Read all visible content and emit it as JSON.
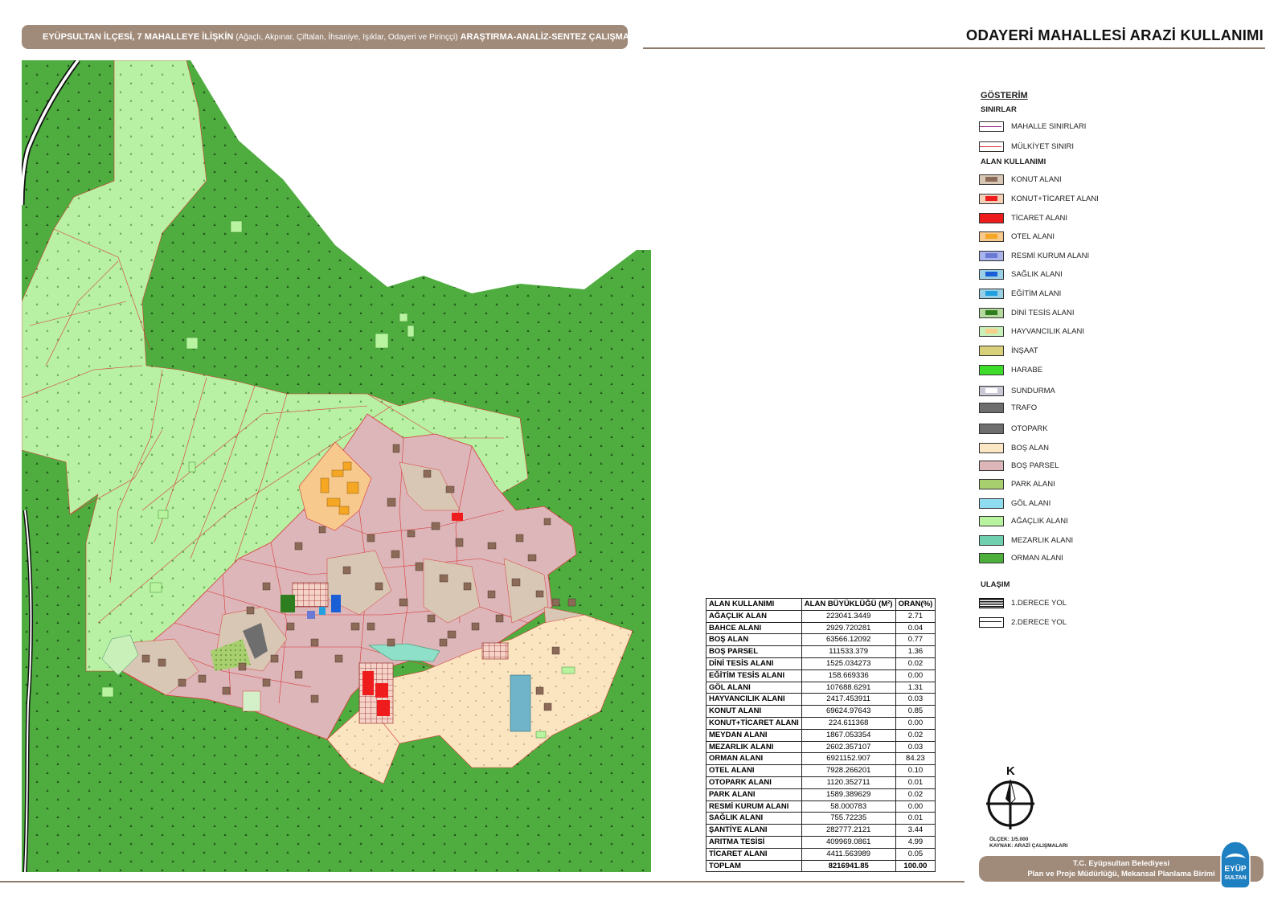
{
  "header": {
    "left_main": "EYÜPSULTAN İLÇESİ, 7 MAHALLEYE İLİŞKİN",
    "left_sub": "(Ağaçlı, Akpınar, Çiftalan, İhsaniye, Işıklar, Odayeri ve Pirinççi)",
    "left_tail": "ARAŞTIRMA-ANALİZ-SENTEZ ÇALIŞMALARI",
    "title": "ODAYERİ MAHALLESİ ARAZİ KULLANIMI"
  },
  "legend": {
    "title": "GÖSTERİM",
    "sections": {
      "sinirlar": "SINIRLAR",
      "alan": "ALAN KULLANIMI",
      "ulasim": "ULAŞIM"
    },
    "boundaries": [
      {
        "label": "MAHALLE SINIRLARI",
        "color": "#9c3a8c"
      },
      {
        "label": "MÜLKİYET SINIRI",
        "color": "#d9383a"
      }
    ],
    "landuse": [
      {
        "label": "KONUT ALANI",
        "color": "#8c6a58",
        "bg": "#d8c7b4"
      },
      {
        "label": "KONUT+TİCARET ALANI",
        "color": "#ee1c1c",
        "bg": "#f4cfb8"
      },
      {
        "label": "TİCARET ALANI",
        "color": "#ee1c1c",
        "bg": "#ee1c1c"
      },
      {
        "label": "OTEL ALANI",
        "color": "#f5a623",
        "bg": "#f7c98c"
      },
      {
        "label": "RESMİ KURUM ALANI",
        "color": "#6a78d6",
        "bg": "#aab4ec"
      },
      {
        "label": "SAĞLIK ALANI",
        "color": "#1a5fd6",
        "bg": "#9ad0e6"
      },
      {
        "label": "EĞİTİM ALANI",
        "color": "#22a0e0",
        "bg": "#9ad0e6"
      },
      {
        "label": "DİNİ TESİS ALANI",
        "color": "#2e7d1e",
        "bg": "#b6d9a0"
      },
      {
        "label": "HAYVANCILIK ALANI",
        "color": "#f7d08a",
        "bg": "#c8f0b8"
      },
      {
        "label": "İNŞAAT",
        "color": "#d8d07a",
        "bg": "#d8d07a"
      },
      {
        "label": "HARABE",
        "color": "#3ddc2a",
        "bg": "#3ddc2a"
      },
      {
        "label": "SUNDURMA",
        "color": "#ffffff",
        "bg": "#c9cad6"
      },
      {
        "label": "TRAFO",
        "color": "#6e6e6e",
        "bg": "#6e6e6e"
      },
      {
        "label": "OTOPARK",
        "color": "#6e6e6e",
        "bg": "#6e6e6e"
      },
      {
        "label": "BOŞ ALAN",
        "color": "#fbe7c4",
        "bg": "#fbe7c4"
      },
      {
        "label": "BOŞ PARSEL",
        "color": "#dcb6b8",
        "bg": "#dcb6b8"
      },
      {
        "label": "PARK ALANI",
        "color": "#a7cf6e",
        "bg": "#a7cf6e"
      },
      {
        "label": "GÖL ALANI",
        "color": "#8fdcf0",
        "bg": "#8fdcf0"
      },
      {
        "label": "AĞAÇLIK ALANI",
        "color": "#b8f4a0",
        "bg": "#b8f4a0"
      },
      {
        "label": "MEZARLIK ALANI",
        "color": "#6fd0b0",
        "bg": "#6fd0b0"
      },
      {
        "label": "ORMAN ALANI",
        "color": "#4caf3c",
        "bg": "#4caf3c"
      }
    ],
    "roads": [
      {
        "label": "1.DERECE YOL"
      },
      {
        "label": "2.DERECE YOL"
      }
    ]
  },
  "table": {
    "headers": [
      "ALAN KULLANIMI",
      "ALAN BÜYÜKLÜĞÜ (M²)",
      "ORAN(%)"
    ],
    "rows": [
      [
        "AĞAÇLIK ALAN",
        "223041.3449",
        "2.71"
      ],
      [
        "BAHCE ALANI",
        "2929.720281",
        "0.04"
      ],
      [
        "BOŞ ALAN",
        "63566.12092",
        "0.77"
      ],
      [
        "BOŞ PARSEL",
        "111533.379",
        "1.36"
      ],
      [
        "DİNİ TESİS ALANI",
        "1525.034273",
        "0.02"
      ],
      [
        "EĞİTİM TESİS ALANI",
        "158.669336",
        "0.00"
      ],
      [
        "GÖL ALANI",
        "107688.6291",
        "1.31"
      ],
      [
        "HAYVANCILIK ALANI",
        "2417.453911",
        "0.03"
      ],
      [
        "KONUT ALANI",
        "69624.97643",
        "0.85"
      ],
      [
        "KONUT+TİCARET ALANI",
        "224.611368",
        "0.00"
      ],
      [
        "MEYDAN ALANI",
        "1867.053354",
        "0.02"
      ],
      [
        "MEZARLIK ALANI",
        "2602.357107",
        "0.03"
      ],
      [
        "ORMAN ALANI",
        "6921152.907",
        "84.23"
      ],
      [
        "OTEL ALANI",
        "7928.266201",
        "0.10"
      ],
      [
        "OTOPARK ALANI",
        "1120.352711",
        "0.01"
      ],
      [
        "PARK ALANI",
        "1589.389629",
        "0.02"
      ],
      [
        "RESMİ KURUM ALANI",
        "58.000783",
        "0.00"
      ],
      [
        "SAĞLIK ALANI",
        "755.72235",
        "0.01"
      ],
      [
        "ŞANTİYE ALANI",
        "282777.2121",
        "3.44"
      ],
      [
        "ARITMA TESİSİ",
        "409969.0861",
        "4.99"
      ],
      [
        "TİCARET ALANI",
        "4411.563989",
        "0.05"
      ]
    ],
    "total": [
      "TOPLAM",
      "8216941.85",
      "100.00"
    ]
  },
  "north_label": "K",
  "scale": "ÖLÇEK: 1/5.000",
  "source": "KAYNAK: ARAZİ ÇALIŞMALARI",
  "footer": {
    "line1": "T.C. Eyüpsultan Belediyesi",
    "line2": "Plan ve Proje Müdürlüğü, Mekansal Planlama Birimi"
  },
  "logo_text": [
    "EYÜP",
    "SULTAN"
  ]
}
